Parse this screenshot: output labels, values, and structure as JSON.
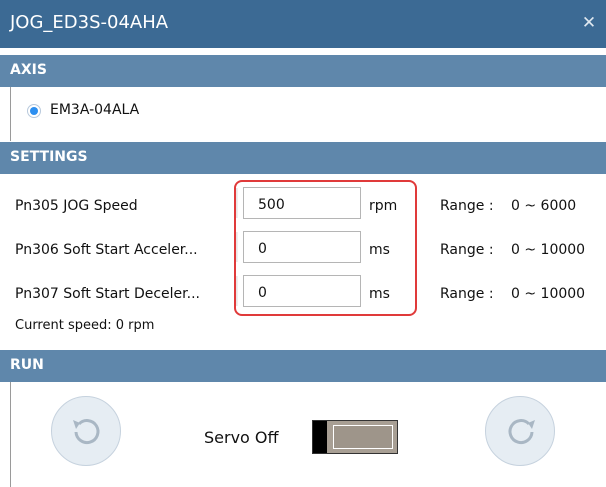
{
  "window": {
    "title": "JOG_ED3S-04AHA",
    "close_icon": "close-icon"
  },
  "axis": {
    "header": "AXIS",
    "selected_option": "EM3A-04ALA"
  },
  "settings": {
    "header": "SETTINGS",
    "params": [
      {
        "label": "Pn305 JOG Speed",
        "value": "500",
        "unit": "rpm",
        "range_label": "Range :",
        "range_value": "0 ~ 6000"
      },
      {
        "label": "Pn306 Soft Start Acceler...",
        "value": "0",
        "unit": "ms",
        "range_label": "Range :",
        "range_value": "0 ~ 10000"
      },
      {
        "label": "Pn307 Soft Start Deceler...",
        "value": "0",
        "unit": "ms",
        "range_label": "Range :",
        "range_value": "0 ~ 10000"
      }
    ],
    "current_speed": "Current speed: 0 rpm"
  },
  "run": {
    "header": "RUN",
    "servo_label": "Servo Off",
    "servo_on": false,
    "reverse_icon": "rotate-ccw-icon",
    "forward_icon": "rotate-cw-icon"
  },
  "colors": {
    "titlebar": "#3c6a94",
    "section_header": "#5f87ab",
    "highlight": "#e03a3a",
    "radio_accent": "#2d8ff0"
  }
}
